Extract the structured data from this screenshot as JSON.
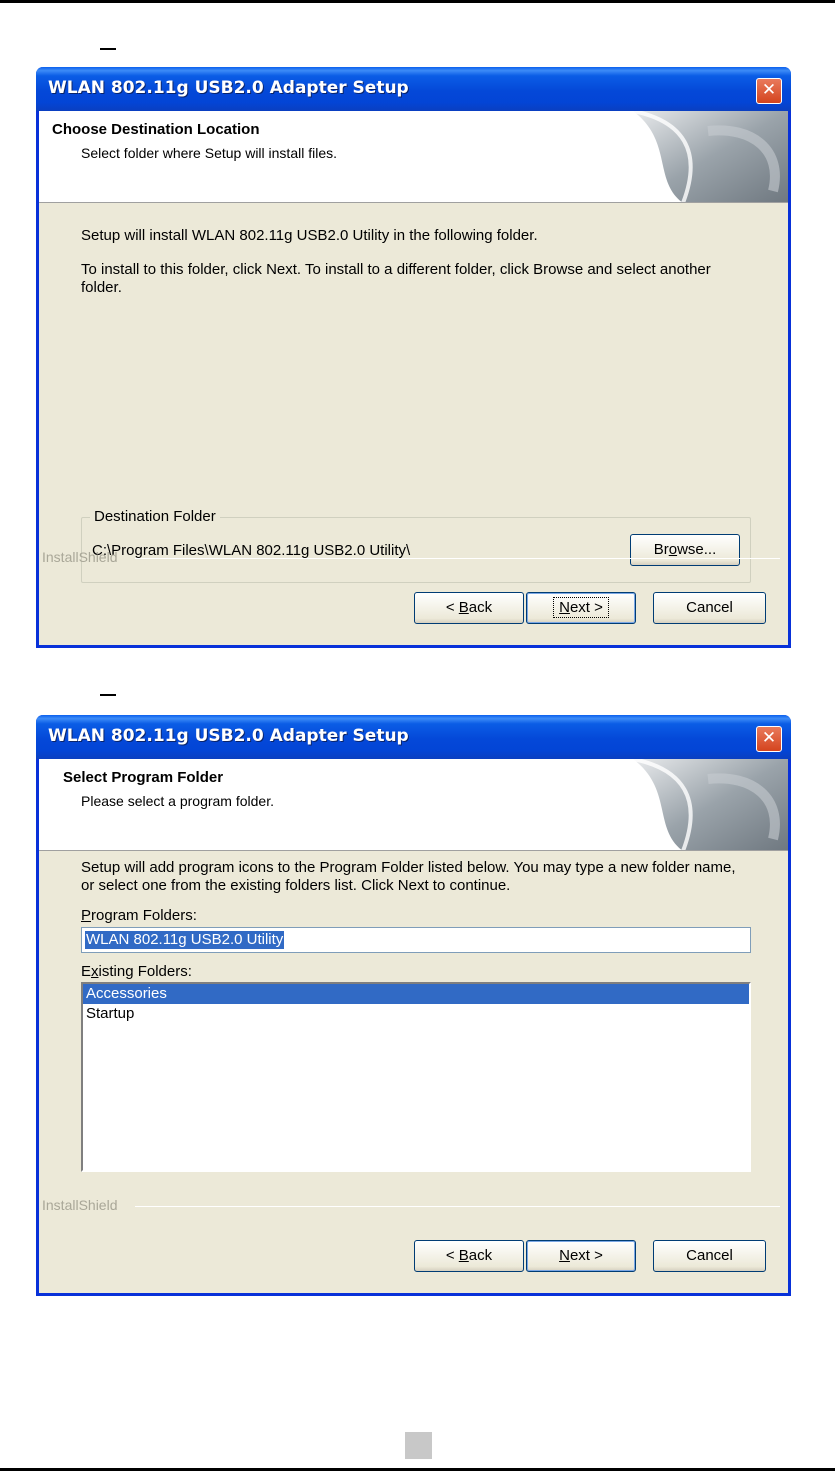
{
  "window1": {
    "title": "WLAN 802.11g USB2.0 Adapter Setup",
    "header_title": "Choose Destination Location",
    "header_subtitle": "Select folder where Setup will install files.",
    "para1": "Setup will install WLAN 802.11g USB2.0 Utility in the following folder.",
    "para2": "To install to this folder, click Next. To install to a different folder, click Browse and select another folder.",
    "group_label": "Destination Folder",
    "destination_path": "C:\\Program Files\\WLAN 802.11g USB2.0 Utility\\",
    "browse_pre": "Br",
    "browse_u": "o",
    "browse_post": "wse...",
    "footer_brand": "InstallShield",
    "back_pre": "< ",
    "back_u": "B",
    "back_post": "ack",
    "next_u": "N",
    "next_post": "ext >",
    "cancel_label": "Cancel"
  },
  "window2": {
    "title": "WLAN 802.11g USB2.0 Adapter Setup",
    "header_title": "Select Program Folder",
    "header_subtitle": "Please select a program folder.",
    "instructions": "Setup will add program icons to the Program Folder listed below.  You may type a new folder name, or select one from the existing folders list.  Click Next to continue.",
    "program_folders_u": "P",
    "program_folders_post": "rogram Folders:",
    "program_folder_value": "WLAN 802.11g USB2.0 Utility",
    "existing_pre": "E",
    "existing_u": "x",
    "existing_post": "isting Folders:",
    "existing_folders": [
      "Accessories",
      "Startup"
    ],
    "selected_index": 0,
    "footer_brand": "InstallShield",
    "back_pre": "< ",
    "back_u": "B",
    "back_post": "ack",
    "next_u": "N",
    "next_post": "ext >",
    "cancel_label": "Cancel"
  },
  "icons": {
    "close": "close-icon"
  },
  "colors": {
    "titlebar": "#0054e3",
    "dialog_bg": "#ece9d8",
    "selection": "#316ac5"
  }
}
